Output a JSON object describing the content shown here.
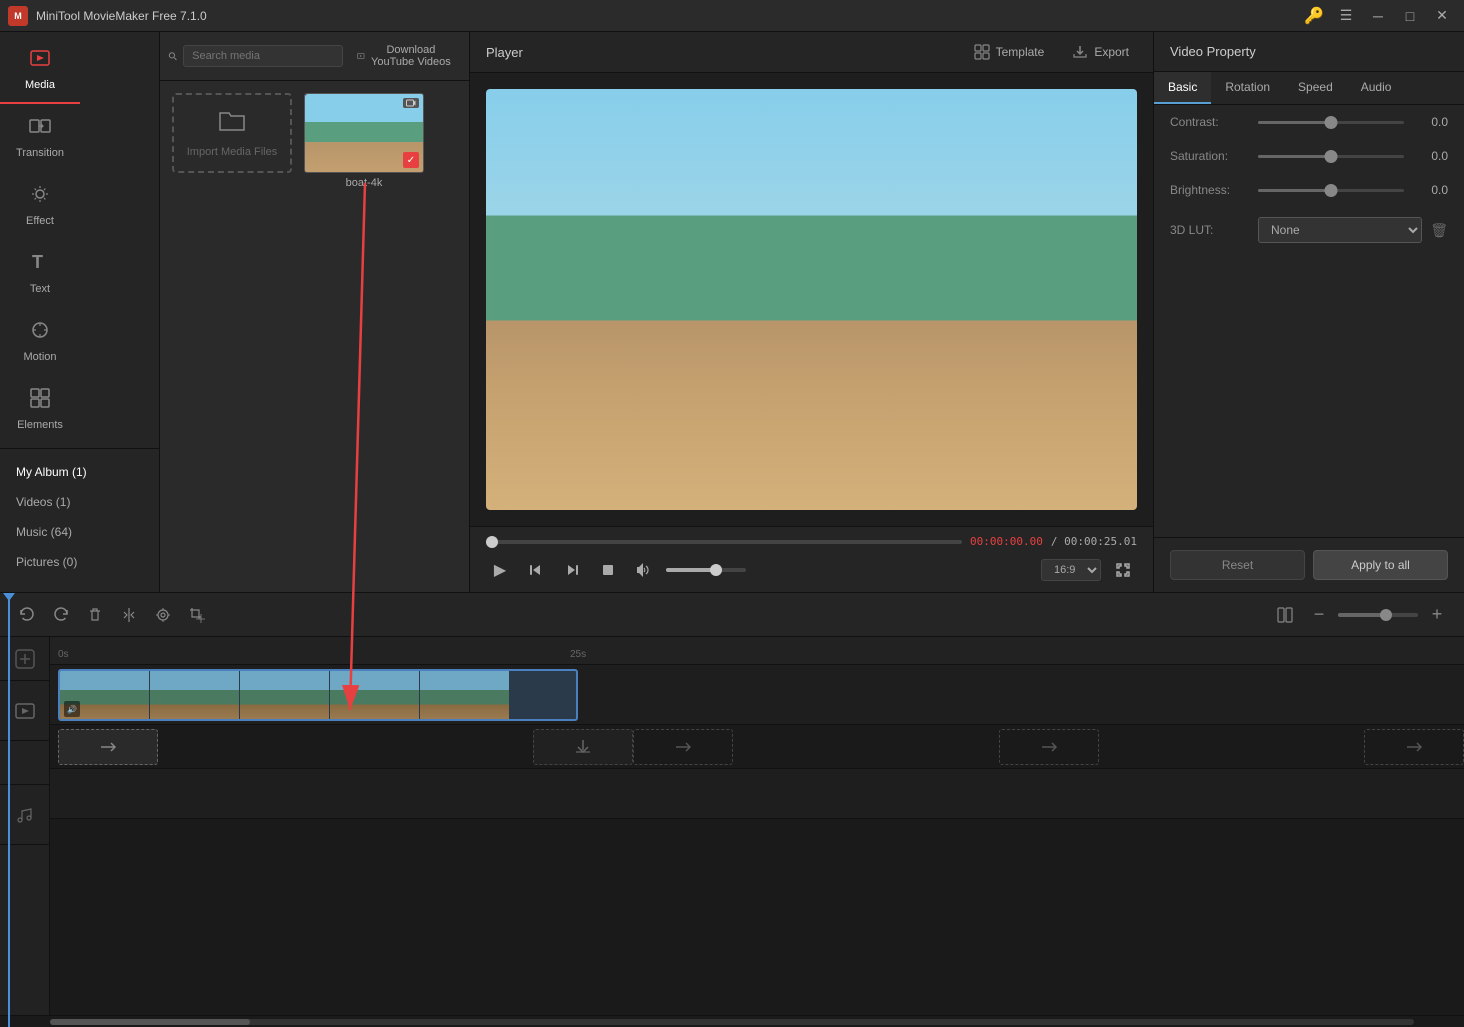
{
  "app": {
    "title": "MiniTool MovieMaker Free 7.1.0",
    "icon": "M"
  },
  "titlebar": {
    "title": "MiniTool MovieMaker Free 7.1.0",
    "controls": [
      "minimize",
      "maximize",
      "close"
    ]
  },
  "toolbar": {
    "items": [
      {
        "id": "media",
        "label": "Media",
        "icon": "🎬",
        "active": true
      },
      {
        "id": "transition",
        "label": "Transition",
        "icon": "⇄"
      },
      {
        "id": "effect",
        "label": "Effect",
        "icon": "✨"
      },
      {
        "id": "text",
        "label": "Text",
        "icon": "T"
      },
      {
        "id": "motion",
        "label": "Motion",
        "icon": "⟳"
      },
      {
        "id": "elements",
        "label": "Elements",
        "icon": "⬡"
      }
    ]
  },
  "sidebar": {
    "nav_items": [
      {
        "id": "my-album",
        "label": "My Album (1)",
        "active": false
      },
      {
        "id": "videos",
        "label": "Videos (1)",
        "active": false
      },
      {
        "id": "music",
        "label": "Music (64)",
        "active": false
      },
      {
        "id": "pictures",
        "label": "Pictures (0)",
        "active": false
      }
    ]
  },
  "media_panel": {
    "search_placeholder": "Search media",
    "download_label": "Download YouTube Videos",
    "import_label": "Import Media Files",
    "media_items": [
      {
        "id": "boat-4k",
        "label": "boat-4k",
        "has_video_icon": true,
        "selected": true
      }
    ]
  },
  "player": {
    "title": "Player",
    "template_label": "Template",
    "export_label": "Export",
    "time_current": "00:00:00.00",
    "time_total": "/ 00:00:25.01",
    "aspect_ratio": "16:9"
  },
  "controls": {
    "play": "▶",
    "prev_frame": "⏮",
    "next_frame": "⏭",
    "stop": "⏹",
    "volume": "🔊"
  },
  "properties": {
    "title": "Video Property",
    "tabs": [
      "Basic",
      "Rotation",
      "Speed",
      "Audio"
    ],
    "active_tab": "Basic",
    "props": [
      {
        "id": "contrast",
        "label": "Contrast:",
        "value": "0.0",
        "percent": 50
      },
      {
        "id": "saturation",
        "label": "Saturation:",
        "value": "0.0",
        "percent": 50
      },
      {
        "id": "brightness",
        "label": "Brightness:",
        "value": "0.0",
        "percent": 50
      }
    ],
    "lut_label": "3D LUT:",
    "lut_value": "None",
    "reset_label": "Reset",
    "apply_label": "Apply to all"
  },
  "timeline": {
    "toolbar_buttons": [
      "undo",
      "redo",
      "delete",
      "split",
      "audio-detach",
      "crop"
    ],
    "ruler_marks": [
      {
        "time": "0s",
        "pos": 8
      },
      {
        "time": "25s",
        "pos": 520
      }
    ],
    "tracks": {
      "video": {
        "icon": "🎬"
      },
      "audio": {
        "icon": "🎵"
      }
    },
    "transition_slots": [
      {
        "id": "t1",
        "type": "arrow",
        "filled": false
      },
      {
        "id": "t2",
        "type": "download",
        "filled": true
      },
      {
        "id": "t3",
        "type": "arrow",
        "filled": false
      },
      {
        "id": "t4",
        "type": "arrow",
        "filled": false
      },
      {
        "id": "t5",
        "type": "arrow",
        "filled": false
      }
    ]
  }
}
